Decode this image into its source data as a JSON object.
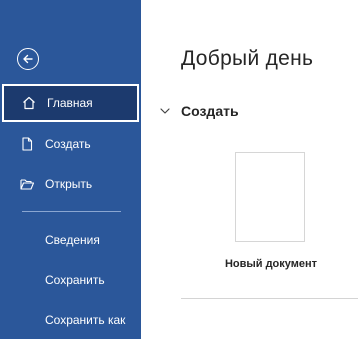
{
  "sidebar": {
    "back_icon": "arrow-left-circle-icon",
    "items": [
      {
        "label": "Главная",
        "icon": "home-icon",
        "active": true
      },
      {
        "label": "Создать",
        "icon": "new-document-icon"
      },
      {
        "label": "Открыть",
        "icon": "folder-open-icon"
      },
      {
        "label": "Сведения"
      },
      {
        "label": "Сохранить"
      },
      {
        "label": "Сохранить как"
      }
    ]
  },
  "main": {
    "greeting": "Добрый день",
    "section": {
      "title": "Создать",
      "icon": "chevron-down-icon"
    },
    "templates": [
      {
        "label": "Новый документ"
      }
    ]
  },
  "colors": {
    "sidebar_bg": "#2b579a",
    "active_bg": "#1c3a6e",
    "text": "#262626"
  }
}
